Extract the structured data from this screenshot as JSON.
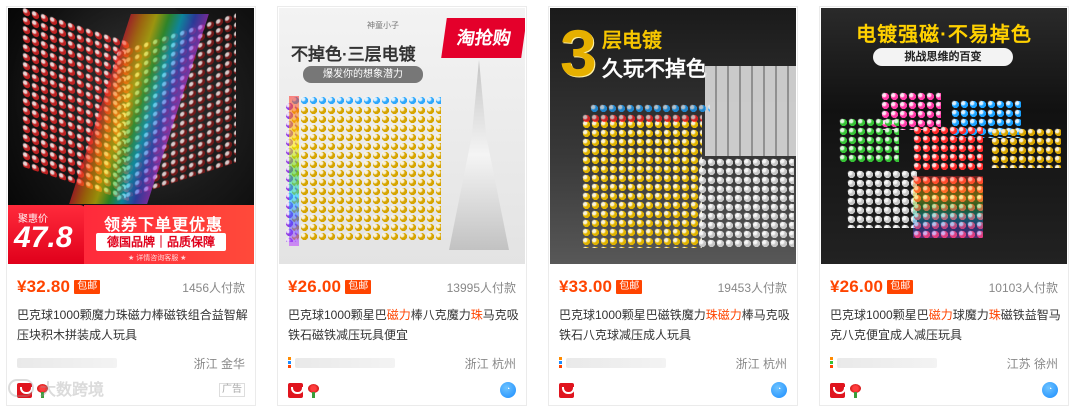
{
  "products": [
    {
      "price": "¥32.80",
      "baoyou": "包邮",
      "sales": "1456人付款",
      "title_parts": [
        {
          "text": "巴克球1000颗魔力珠磁力棒磁铁组合益智解压块积木拼装成人玩具",
          "hl": false
        }
      ],
      "location": "浙江 金华",
      "right_tag": "广告",
      "image": {
        "promo": {
          "label": "聚惠价",
          "price": "47.8",
          "line1": "领券下单更优惠",
          "line2": "德国品牌｜品质保障",
          "line3": "★ 详情咨询客服 ★"
        }
      },
      "colors": {
        "accent": "#ff4400"
      }
    },
    {
      "price": "¥26.00",
      "baoyou": "包邮",
      "sales": "13995人付款",
      "title_parts": [
        {
          "text": "巴克球1000颗星巴",
          "hl": false
        },
        {
          "text": "磁力",
          "hl": true
        },
        {
          "text": "棒八克魔力",
          "hl": false
        },
        {
          "text": "珠",
          "hl": true
        },
        {
          "text": "马克吸铁石磁铁减压玩具便宜",
          "hl": false
        }
      ],
      "location": "浙江 杭州",
      "image": {
        "brand": "神童小子",
        "headline": "不掉色·三层电镀",
        "pill": "爆发你的想象潜力",
        "tao": "淘抢购"
      }
    },
    {
      "price": "¥33.00",
      "baoyou": "包邮",
      "sales": "19453人付款",
      "title_parts": [
        {
          "text": "巴克球1000颗星巴磁铁魔力",
          "hl": false
        },
        {
          "text": "珠磁力",
          "hl": true
        },
        {
          "text": "棒马克吸铁石八克球减压成人玩具",
          "hl": false
        }
      ],
      "location": "浙江 杭州",
      "image": {
        "big": "3",
        "line1": "层电镀",
        "line2": "久玩不掉色"
      }
    },
    {
      "price": "¥26.00",
      "baoyou": "包邮",
      "sales": "10103人付款",
      "title_parts": [
        {
          "text": "巴克球1000颗星巴",
          "hl": false
        },
        {
          "text": "磁力",
          "hl": true
        },
        {
          "text": "球魔力",
          "hl": false
        },
        {
          "text": "珠",
          "hl": true
        },
        {
          "text": "磁铁益智马克八克便宜成人减压玩具",
          "hl": false
        }
      ],
      "location": "江苏 徐州",
      "image": {
        "headline": "电镀强磁·不易掉色",
        "sub": "挑战思维的百变"
      }
    }
  ],
  "watermark": {
    "text": "大数跨境"
  }
}
